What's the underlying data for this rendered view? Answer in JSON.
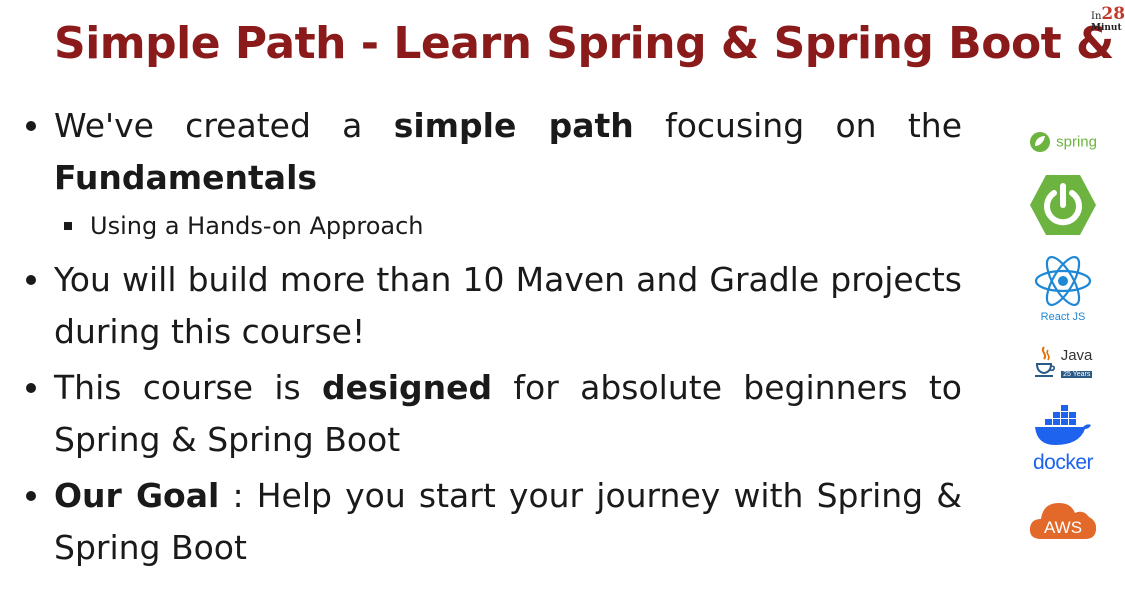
{
  "slide": {
    "title": "Simple Path - Learn Spring & Spring Boot & ...",
    "corner_logo": {
      "prefix": "In",
      "number": "28",
      "suffix": "Minut"
    }
  },
  "bullets": [
    {
      "parts": [
        {
          "text": "We've created a ",
          "bold": false
        },
        {
          "text": "simple path",
          "bold": true
        },
        {
          "text": " focusing on the ",
          "bold": false
        },
        {
          "text": "Fundamentals",
          "bold": true
        }
      ],
      "subitems": [
        "Using a Hands-on Approach"
      ]
    },
    {
      "parts": [
        {
          "text": "You will build more than 10 Maven and Gradle projects during this course!",
          "bold": false
        }
      ],
      "subitems": []
    },
    {
      "parts": [
        {
          "text": "This course is ",
          "bold": false
        },
        {
          "text": "designed",
          "bold": true
        },
        {
          "text": " for absolute beginners to Spring & Spring Boot",
          "bold": false
        }
      ],
      "subitems": []
    },
    {
      "parts": [
        {
          "text": "Our Goal",
          "bold": true
        },
        {
          "text": " : Help you start your journey with Spring & Spring Boot",
          "bold": false
        }
      ],
      "subitems": []
    }
  ],
  "logos": {
    "spring": {
      "label": "spring",
      "icon": "spring-leaf-icon",
      "color": "#6db33f"
    },
    "spring_boot": {
      "icon": "spring-boot-power-icon",
      "color": "#6db33f"
    },
    "react": {
      "label": "React JS",
      "icon": "react-atom-icon",
      "color": "#1e88d6"
    },
    "java": {
      "label": "Java",
      "years": "25 Years",
      "icon": "java-cup-icon"
    },
    "docker": {
      "label": "docker",
      "icon": "docker-whale-icon",
      "color": "#1d63ed"
    },
    "aws": {
      "label": "AWS",
      "icon": "aws-cloud-icon",
      "color": "#e2692a"
    }
  }
}
